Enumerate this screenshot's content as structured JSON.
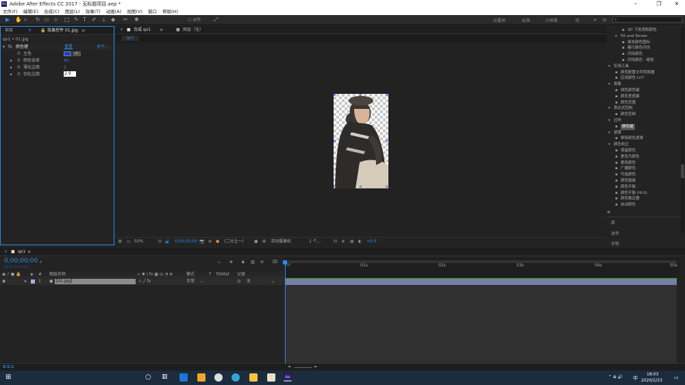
{
  "app": {
    "title": "Adobe After Effects CC 2017 - 无标题项目.aep *",
    "logo": "Ae"
  },
  "menu": [
    "文件(F)",
    "编辑(E)",
    "合成(C)",
    "图层(L)",
    "效果(T)",
    "动画(A)",
    "视图(V)",
    "窗口",
    "帮助(H)"
  ],
  "toolbar": {
    "align_label": "对齐",
    "workspaces": [
      "必要项",
      "标准",
      "小屏幕",
      "库"
    ]
  },
  "search": {
    "placeholder": ""
  },
  "fx": {
    "tab_project": "项目",
    "tab_fx": "效果控件 01.jpg",
    "breadcrumb": "qx1 • 01.jpg",
    "effect_name": "颜色键",
    "reset": "重置",
    "about": "关于...",
    "props": [
      {
        "label": "主色",
        "value": ""
      },
      {
        "label": "颜色容差",
        "value": "45"
      },
      {
        "label": "薄化边缘",
        "value": "2"
      },
      {
        "label": "羽化边缘",
        "value": "2.9"
      }
    ]
  },
  "comp": {
    "tab_comp": "合成 qx1",
    "tab_layer": "图层（无）",
    "subtab": "qx1",
    "footer": {
      "zoom": "50%",
      "timecode": "0;00;00;00",
      "res": "(二分之一)",
      "camera": "活动摄像机",
      "views": "1 个...",
      "exposure": "+0.0"
    }
  },
  "effects_browser": {
    "items": [
      {
        "t": "3D 下雨滴和颜色",
        "lvl": 3
      },
      {
        "t": "Fill and Stroke",
        "lvl": 2,
        "folder": true
      },
      {
        "t": "填充颜色图标",
        "lvl": 3
      },
      {
        "t": "着行颜色闪烁",
        "lvl": 3
      },
      {
        "t": "闪烁颜色",
        "lvl": 3
      },
      {
        "t": "闪烁颜色 - 缩放",
        "lvl": 3
      },
      {
        "t": "实用工具",
        "lvl": 1,
        "folder": true
      },
      {
        "t": "颜色配置文件转换器",
        "lvl": 2
      },
      {
        "t": "应用颜色 LUT",
        "lvl": 2
      },
      {
        "t": "抠像",
        "lvl": 1,
        "folder": true
      },
      {
        "t": "线性颜色键",
        "lvl": 2
      },
      {
        "t": "颜色差值键",
        "lvl": 2
      },
      {
        "t": "颜色范围",
        "lvl": 2
      },
      {
        "t": "表达式控制",
        "lvl": 1,
        "folder": true
      },
      {
        "t": "颜色控制",
        "lvl": 2
      },
      {
        "t": "过时",
        "lvl": 1,
        "folder": true
      },
      {
        "t": "颜色键",
        "lvl": 2,
        "selected": true
      },
      {
        "t": "遮罩",
        "lvl": 1,
        "folder": true
      },
      {
        "t": "移除颜色遮罩",
        "lvl": 2
      },
      {
        "t": "颜色校正",
        "lvl": 1,
        "folder": true
      },
      {
        "t": "保留颜色",
        "lvl": 2
      },
      {
        "t": "更改为颜色",
        "lvl": 2
      },
      {
        "t": "更改颜色",
        "lvl": 2
      },
      {
        "t": "广播颜色",
        "lvl": 2
      },
      {
        "t": "可选颜色",
        "lvl": 2
      },
      {
        "t": "颜色链接",
        "lvl": 2
      },
      {
        "t": "颜色平衡",
        "lvl": 2
      },
      {
        "t": "颜色平衡 (HLS)",
        "lvl": 2
      },
      {
        "t": "颜色稳定器",
        "lvl": 2
      },
      {
        "t": "自动颜色",
        "lvl": 2
      }
    ],
    "panels": [
      "库",
      "对齐",
      "字符"
    ]
  },
  "timeline": {
    "tab": "qx1",
    "timecode": "0;00;00;00",
    "timecode_sub": "00000 (29.97 fps)",
    "headers": {
      "layer_name": "图层名称",
      "mode": "模式",
      "t": "T",
      "trkmat": "TrkMat",
      "parent": "父级"
    },
    "ruler": [
      "0f",
      "01s",
      "02s",
      "03s",
      "04s",
      "05s"
    ],
    "layer": {
      "num": "1",
      "name": "[01.jpg]",
      "mode": "正常",
      "parent": "无"
    }
  },
  "taskbar": {
    "time": "18:03",
    "date": "2020/2/23",
    "lang": "中"
  }
}
